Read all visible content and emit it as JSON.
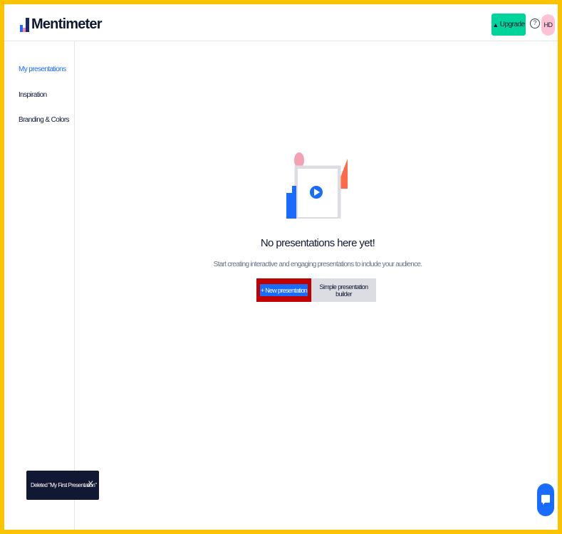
{
  "header": {
    "logo_text": "Mentimeter",
    "upgrade_label": "Upgrade",
    "avatar_initials": "HD",
    "help_symbol": "?"
  },
  "sidebar": {
    "items": [
      {
        "label": "My presentations",
        "active": true
      },
      {
        "label": "Inspiration",
        "active": false
      },
      {
        "label": "Branding & Colors",
        "active": false
      }
    ]
  },
  "main": {
    "empty_title": "No presentations here yet!",
    "empty_subtitle": "Start creating interactive and engaging presentations to include your audience.",
    "new_presentation_label": "+ New presentation",
    "simple_builder_label": "Simple presentation builder"
  },
  "toast": {
    "message": "Deleted \"My First Presentation\"",
    "close_symbol": "X"
  },
  "colors": {
    "accent": "#196cff",
    "upgrade": "#00d49a",
    "frame": "#fbc200",
    "highlight": "#c00000",
    "avatar": "#ffc2d4"
  },
  "icons": [
    "upgrade-arrow-icon",
    "help-icon",
    "play-icon",
    "chat-icon",
    "close-icon"
  ]
}
